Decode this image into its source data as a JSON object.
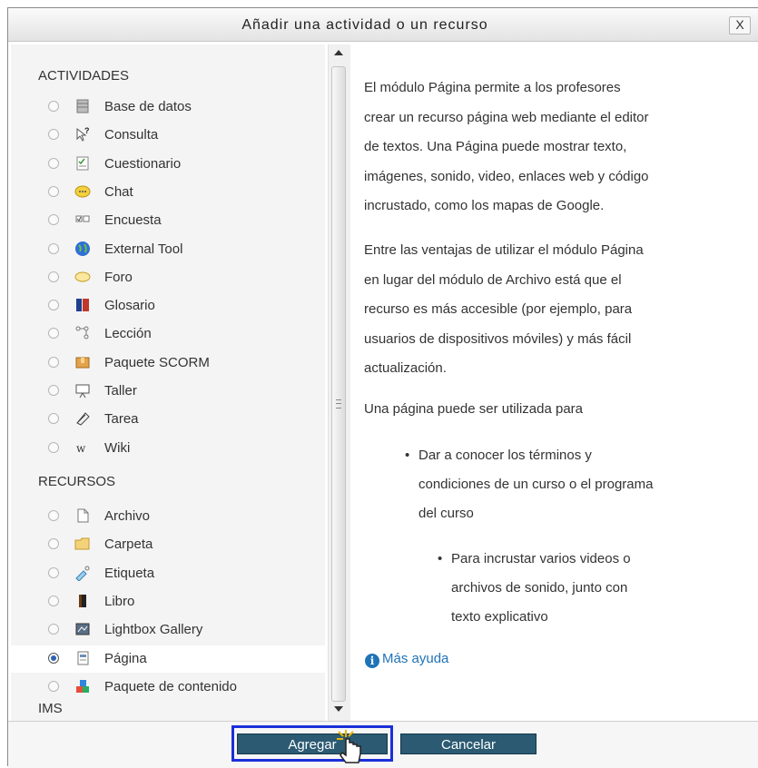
{
  "dialog": {
    "title": "Añadir una actividad o un recurso",
    "close_label": "X"
  },
  "activities": {
    "heading": "ACTIVIDADES",
    "items": [
      {
        "label": "Base de datos",
        "icon": "database-icon"
      },
      {
        "label": "Consulta",
        "icon": "choice-icon"
      },
      {
        "label": "Cuestionario",
        "icon": "quiz-icon"
      },
      {
        "label": "Chat",
        "icon": "chat-icon"
      },
      {
        "label": "Encuesta",
        "icon": "survey-icon"
      },
      {
        "label": "External Tool",
        "icon": "globe-icon"
      },
      {
        "label": "Foro",
        "icon": "forum-icon"
      },
      {
        "label": "Glosario",
        "icon": "glossary-icon"
      },
      {
        "label": "Lección",
        "icon": "lesson-icon"
      },
      {
        "label": "Paquete SCORM",
        "icon": "scorm-package-icon"
      },
      {
        "label": "Taller",
        "icon": "workshop-icon"
      },
      {
        "label": "Tarea",
        "icon": "assignment-icon"
      },
      {
        "label": "Wiki",
        "icon": "wiki-icon"
      }
    ]
  },
  "resources": {
    "heading": "RECURSOS",
    "items": [
      {
        "label": "Archivo",
        "icon": "file-icon"
      },
      {
        "label": "Carpeta",
        "icon": "folder-icon"
      },
      {
        "label": "Etiqueta",
        "icon": "label-icon"
      },
      {
        "label": "Libro",
        "icon": "book-icon"
      },
      {
        "label": "Lightbox Gallery",
        "icon": "gallery-icon"
      },
      {
        "label": "Página",
        "icon": "page-icon",
        "selected": true
      },
      {
        "label": "Paquete de contenido",
        "label2": "IMS",
        "icon": "ims-package-icon"
      }
    ]
  },
  "description": {
    "paragraphs": [
      [
        "El módulo Página permite a los profesores",
        "crear un recurso página web mediante el editor",
        "de textos. Una Página puede mostrar texto,",
        "imágenes, sonido, video, enlaces web y código",
        "incrustado, como los mapas de Google."
      ],
      [
        "Entre las ventajas de utilizar el módulo Página",
        "en lugar del módulo de Archivo está que el",
        "recurso es más accesible (por ejemplo, para",
        "usuarios de dispositivos móviles) y más fácil",
        "actualización."
      ],
      [
        "Una página puede ser utilizada para"
      ]
    ],
    "bullet1": [
      "Dar a conocer los términos y",
      "condiciones de un curso o el programa",
      "del curso"
    ],
    "bullet2": [
      "Para incrustar varios videos o",
      "archivos de sonido, junto con",
      "texto explicativo"
    ],
    "help_link": "Más ayuda"
  },
  "footer": {
    "add_label": "Agregar",
    "cancel_label": "Cancelar"
  },
  "colors": {
    "accent": "#1f73b7",
    "button": "#2b5a72",
    "highlight": "#1b2fd8"
  }
}
